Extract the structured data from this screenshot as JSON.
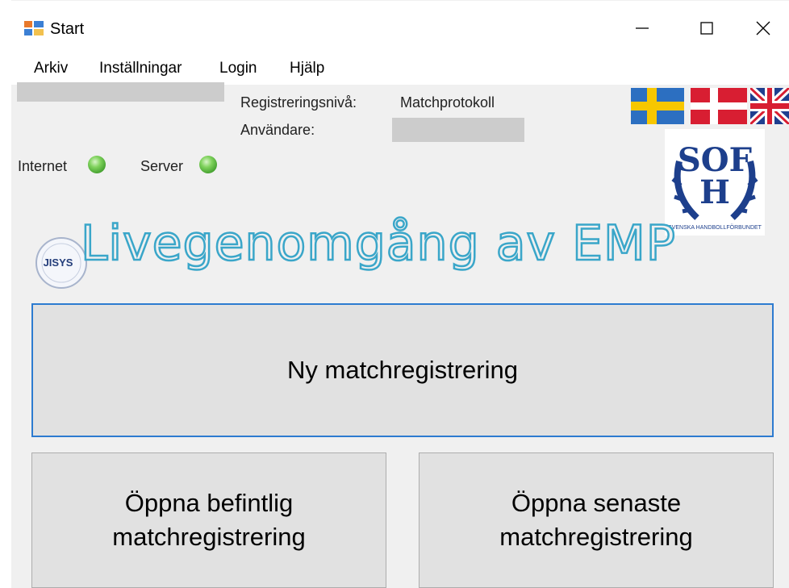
{
  "window": {
    "title": "Start",
    "controls": {
      "minimize": "minimize",
      "maximize": "maximize",
      "close": "close"
    }
  },
  "menu": {
    "items": [
      {
        "label": "Arkiv"
      },
      {
        "label": "Inställningar"
      },
      {
        "label": "Login"
      },
      {
        "label": "Hjälp"
      }
    ]
  },
  "info": {
    "level_label": "Registreringsnivå:",
    "level_value": "Matchprotokoll",
    "user_label": "Användare:"
  },
  "status": {
    "internet_label": "Internet",
    "server_label": "Server",
    "led_color": "#4fb33a"
  },
  "flags": [
    "swedish-flag",
    "danish-flag",
    "uk-flag"
  ],
  "logos": {
    "sof_letters": "SOF",
    "sof_text": "SVENSKA HANDBOLLFÖRBUNDET",
    "jisy_text": "JISYS"
  },
  "overlay_text": "Livegenomgång av EMP",
  "buttons": {
    "new_match": "Ny matchregistrering",
    "open_existing_line1": "Öppna befintlig",
    "open_existing_line2": "matchregistrering",
    "open_latest_line1": "Öppna senaste",
    "open_latest_line2": "matchregistrering"
  },
  "colors": {
    "accent_border": "#2d7bd0",
    "overlay_outline": "#3aa6c9",
    "button_bg": "#e1e1e1"
  }
}
